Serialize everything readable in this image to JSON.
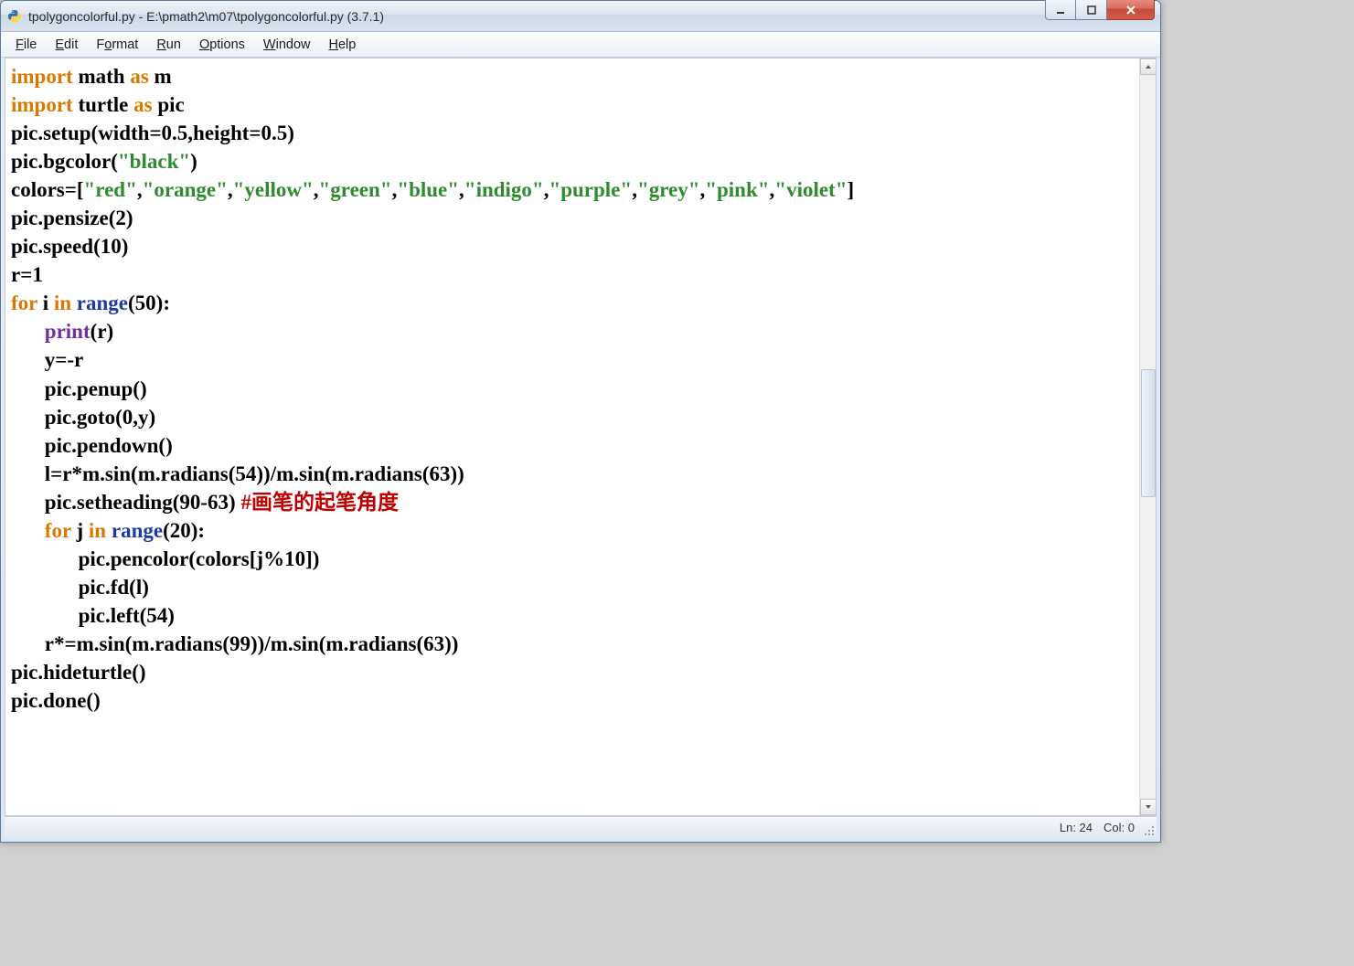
{
  "title": "tpolygoncolorful.py - E:\\pmath2\\m07\\tpolygoncolorful.py (3.7.1)",
  "menu": {
    "file": "File",
    "edit": "Edit",
    "format": "Format",
    "run": "Run",
    "options": "Options",
    "window": "Window",
    "help": "Help"
  },
  "kw": {
    "import": "import",
    "as": "as",
    "for": "for",
    "in": "in",
    "print": "print",
    "range": "range"
  },
  "txt": {
    "math": "math",
    "m": "m",
    "turtle": "turtle",
    "pic": "pic",
    "setup": "pic.setup(width=0.5,height=0.5)",
    "bgcolor_pre": "pic.bgcolor(",
    "black": "\"black\"",
    "bgcolor_post": ")",
    "colors_pre": "colors=[",
    "colors_post": "]",
    "c0": "\"red\"",
    "c1": "\"orange\"",
    "c2": "\"yellow\"",
    "c3": "\"green\"",
    "c4": "\"blue\"",
    "c5": "\"indigo\"",
    "c6": "\"purple\"",
    "c7": "\"grey\"",
    "c8": "\"pink\"",
    "c9": "\"violet\"",
    "comma": ",",
    "pensize": "pic.pensize(2)",
    "speed": "pic.speed(10)",
    "r1": "r=1",
    "space": " ",
    "i": "i",
    "j": "j",
    "for_i_tail": "(50):",
    "for_j_tail": "(20):",
    "print_open": "(",
    "print_arg": "r",
    "print_close": ")",
    "yeq": "y=-r",
    "penup": "pic.penup()",
    "goto": "pic.goto(0,y)",
    "pendown": "pic.pendown()",
    "lcalc": "l=r*m.sin(m.radians(54))/m.sin(m.radians(63))",
    "setheading": "pic.setheading(90-63) ",
    "comment": "#画笔的起笔角度",
    "pencolor": "pic.pencolor(colors[j%10])",
    "fd": "pic.fd(l)",
    "left": "pic.left(54)",
    "rmul": "r*=m.sin(m.radians(99))/m.sin(m.radians(63))",
    "hide": "pic.hideturtle()",
    "done": "pic.done()"
  },
  "status": {
    "ln": "Ln: 24",
    "col": "Col: 0"
  }
}
